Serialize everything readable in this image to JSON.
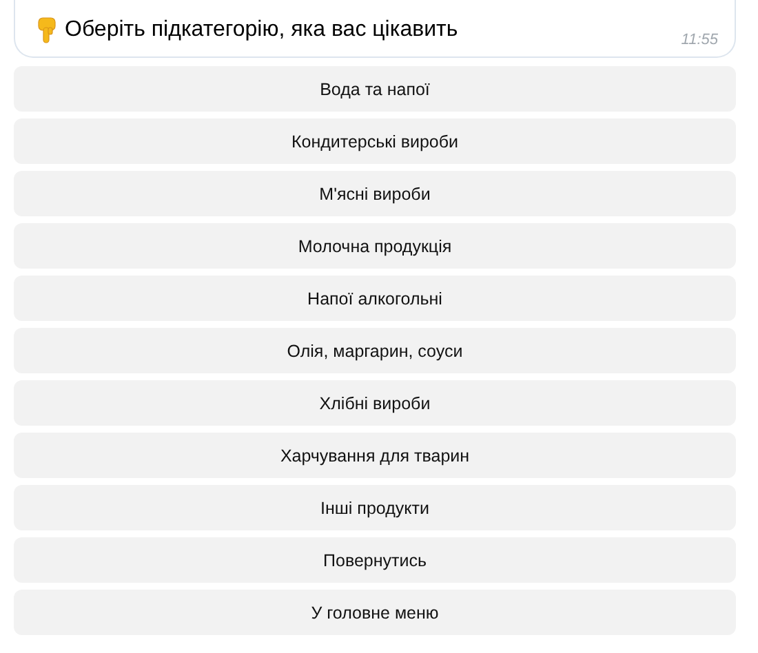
{
  "message": {
    "text": "Оберіть підкатегорію, яка вас цікавить",
    "time": "11:55"
  },
  "buttons": [
    "Вода та напої",
    "Кондитерські вироби",
    "М'ясні вироби",
    "Молочна продукція",
    "Напої алкогольні",
    "Олія, маргарин, соуси",
    "Хлібні вироби",
    "Харчування для тварин",
    "Інші продукти",
    "Повернутись",
    "У головне меню"
  ]
}
